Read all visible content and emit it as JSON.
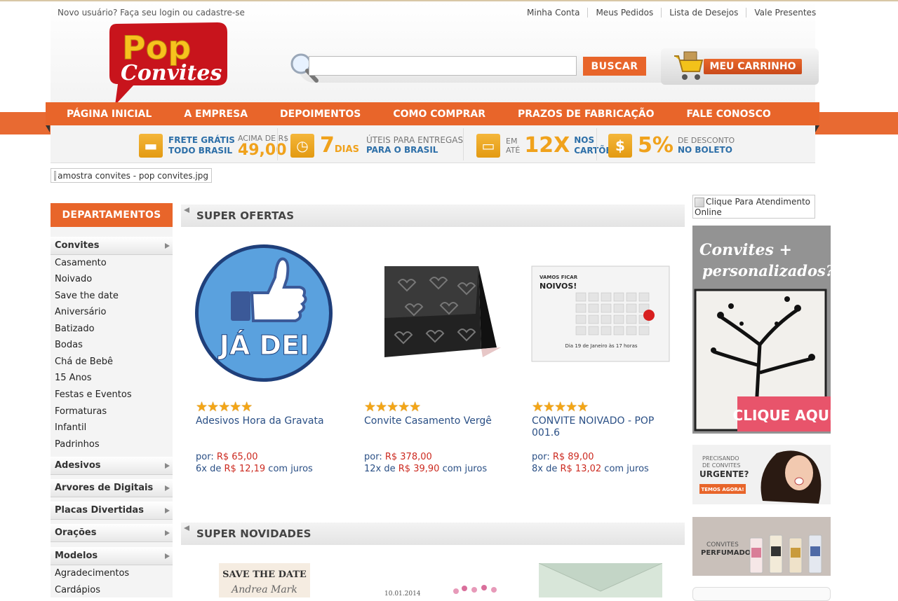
{
  "header": {
    "greeting": "Novo usuário? Faça seu login ou cadastre-se",
    "account_links": [
      "Minha Conta",
      "Meus Pedidos",
      "Lista de Desejos",
      "Vale Presentes"
    ],
    "logo_text_top": "Pop",
    "logo_text_bottom": "Convites",
    "search_placeholder": "",
    "search_button": "BUSCAR",
    "cart_label": "MEU CARRINHO"
  },
  "nav": {
    "items": [
      "PÁGINA INICIAL",
      "A EMPRESA",
      "DEPOIMENTOS",
      "COMO COMPRAR",
      "PRAZOS DE FABRICAÇÃO",
      "FALE CONOSCO"
    ]
  },
  "benefits": {
    "frete_line1": "FRETE GRÁTIS",
    "frete_line2": "TODO BRASIL",
    "frete_acima": "ACIMA DE R$",
    "frete_valor": "49,00",
    "dias_num": "7",
    "dias_label": "DIAS",
    "dias_line1": "ÚTEIS PARA ENTREGAS",
    "dias_line2": "PARA O BRASIL",
    "parc_em": "EM",
    "parc_ate": "ATÉ",
    "parc_num": "12X",
    "parc_line1": "NOS",
    "parc_line2": "CARTÕES",
    "desc_num": "5%",
    "desc_line1": "DE DESCONTO",
    "desc_line2": "NO BOLETO"
  },
  "banner_alt": "amostra convites - pop convites.jpg",
  "sidebar": {
    "title": "DEPARTAMENTOS",
    "categories": [
      {
        "label": "Convites",
        "items": [
          "Casamento",
          "Noivado",
          "Save the date",
          "Aniversário",
          "Batizado",
          "Bodas",
          "Chá de Bebê",
          "15 Anos",
          "Festas e Eventos",
          "Formaturas",
          "Infantil",
          "Padrinhos"
        ]
      },
      {
        "label": "Adesivos",
        "items": []
      },
      {
        "label": "Arvores de Digitais",
        "items": []
      },
      {
        "label": "Placas Divertidas",
        "items": []
      },
      {
        "label": "Orações",
        "items": []
      },
      {
        "label": "Modelos",
        "items": [
          "Agradecimentos",
          "Cardápios"
        ]
      }
    ]
  },
  "sections": {
    "ofertas_title": "SUPER OFERTAS",
    "novidades_title": "SUPER NOVIDADES"
  },
  "products": [
    {
      "name": "Adesivos Hora da Gravata",
      "price_prefix": "por:",
      "price": "R$ 65,00",
      "inst_count": "6x de",
      "inst_value": "R$ 12,19",
      "inst_suffix": "com juros",
      "stars": "★★★★★",
      "image_text": "JÁ DEI",
      "rating": 5
    },
    {
      "name": "Convite Casamento Vergê",
      "price_prefix": "por:",
      "price": "R$ 378,00",
      "inst_count": "12x de",
      "inst_value": "R$ 39,90",
      "inst_suffix": "com juros",
      "stars": "★★★★★",
      "rating": 5
    },
    {
      "name": "CONVITE NOIVADO - POP 001.6",
      "price_prefix": "por:",
      "price": "R$ 89,00",
      "inst_count": "8x de",
      "inst_value": "R$ 13,02",
      "inst_suffix": "com juros",
      "stars": "★★★★★",
      "rating": 5,
      "image_text_1": "VAMOS FICAR",
      "image_text_2": "NOIVOS!",
      "image_text_3": "Dia 19 de Janeiro às 17 horas"
    }
  ],
  "novidades": [
    {
      "image_text_1": "SAVE THE DATE",
      "image_text_2": "Andrea Mark"
    },
    {
      "image_text_1": "10.01.2014"
    },
    {
      "image_text_1": ""
    }
  ],
  "right": {
    "atendimento_alt": "Clique Para Atendimento Online",
    "ad1_line1": "Convites +",
    "ad1_line2": "personalizados?",
    "ad1_cta": "CLIQUE AQUI",
    "ad2_line1": "PRECISANDO",
    "ad2_line2": "DE CONVITES",
    "ad2_line3": "URGENTE?",
    "ad2_cta": "TEMOS AGORA!",
    "ad3_line1": "CONVITES",
    "ad3_line2": "PERFUMADOS"
  },
  "colors": {
    "brand_orange": "#e8652a",
    "logo_red": "#c8141c",
    "logo_yellow": "#f7c21e",
    "link_blue": "#2a4f85",
    "price_red": "#cc2a20",
    "star_gold": "#f3a516"
  }
}
